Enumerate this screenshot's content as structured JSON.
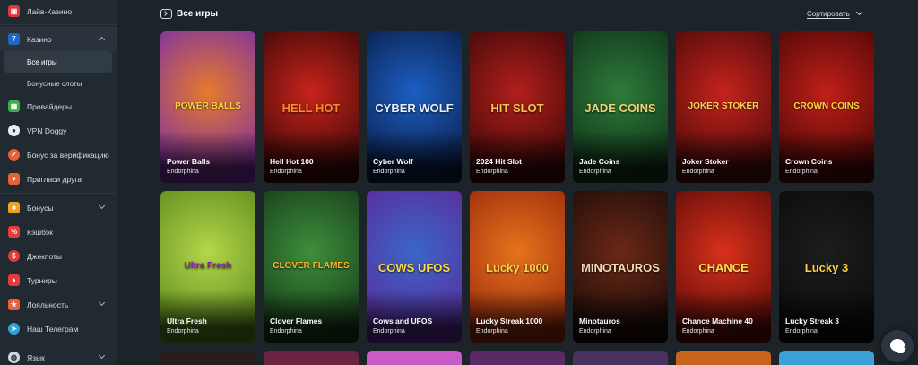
{
  "sidebar": {
    "items": [
      {
        "label": "Лайв-Казино",
        "icon": "live-casino-icon",
        "color": "#e2363b"
      },
      {
        "label": "Казино",
        "icon": "casino-seven-icon",
        "color": "#1f66c6"
      },
      {
        "label": "Все игры"
      },
      {
        "label": "Бонусные слоты"
      },
      {
        "label": "Провайдеры",
        "icon": "providers-icon",
        "color": "#3fae49"
      },
      {
        "label": "VPN Doggy",
        "icon": "vpn-doggy-icon",
        "color": "#e9eef2"
      },
      {
        "label": "Бонус за верификацию",
        "icon": "verification-bonus-icon",
        "color": "#e8603a"
      },
      {
        "label": "Пригласи друга",
        "icon": "invite-friend-icon",
        "color": "#e8603a"
      },
      {
        "label": "Бонусы",
        "icon": "bonuses-icon",
        "color": "#f0a11f"
      },
      {
        "label": "Кэшбэк",
        "icon": "cashback-icon",
        "color": "#e23b3b"
      },
      {
        "label": "Джекпоты",
        "icon": "jackpots-icon",
        "color": "#e23b3b"
      },
      {
        "label": "Турниры",
        "icon": "tournaments-icon",
        "color": "#e23b3b"
      },
      {
        "label": "Лояльность",
        "icon": "loyalty-icon",
        "color": "#e8603a"
      },
      {
        "label": "Наш Телеграм",
        "icon": "telegram-icon",
        "color": "#2aa3dd"
      },
      {
        "label": "Язык",
        "icon": "globe-icon",
        "color": "#cfd6dc"
      }
    ]
  },
  "header": {
    "title": "Все игры",
    "sort_label": "Сортировать"
  },
  "games": [
    {
      "name": "Power Balls",
      "provider": "Endorphina",
      "logo": "POWER BALLS",
      "bg": "#e67a2c",
      "bg2": "#7a2ea6",
      "logo_color": "#ffd23b"
    },
    {
      "name": "Hell Hot 100",
      "provider": "Endorphina",
      "logo": "HELL HOT",
      "bg": "#c8231a",
      "bg2": "#3a0808",
      "logo_color": "#ff8a2a"
    },
    {
      "name": "Cyber Wolf",
      "provider": "Endorphina",
      "logo": "CYBER WOLF",
      "bg": "#1c5fc4",
      "bg2": "#0b1d46",
      "logo_color": "#e6f1ff"
    },
    {
      "name": "2024 Hit Slot",
      "provider": "Endorphina",
      "logo": "HIT SLOT",
      "bg": "#b11f1b",
      "bg2": "#3d0808",
      "logo_color": "#f6c54b"
    },
    {
      "name": "Jade Coins",
      "provider": "Endorphina",
      "logo": "JADE COINS",
      "bg": "#2e7b3a",
      "bg2": "#0e3218",
      "logo_color": "#f2d272"
    },
    {
      "name": "Joker Stoker",
      "provider": "Endorphina",
      "logo": "JOKER STOKER",
      "bg": "#c5231c",
      "bg2": "#4a0a0a",
      "logo_color": "#ffd34f"
    },
    {
      "name": "Crown Coins",
      "provider": "Endorphina",
      "logo": "CROWN COINS",
      "bg": "#c01f17",
      "bg2": "#4c0707",
      "logo_color": "#ffd640"
    },
    {
      "name": "Ultra Fresh",
      "provider": "Endorphina",
      "logo": "Ultra Fresh",
      "bg": "#b6d64a",
      "bg2": "#5b8a1c",
      "logo_color": "#8a1cb3"
    },
    {
      "name": "Clover Flames",
      "provider": "Endorphina",
      "logo": "CLOVER FLAMES",
      "bg": "#3d8f3a",
      "bg2": "#173b1a",
      "logo_color": "#ffb12c"
    },
    {
      "name": "Cows and UFOS",
      "provider": "Endorphina",
      "logo": "COWS UFOS",
      "bg": "#3a66c8",
      "bg2": "#5c2a9a",
      "logo_color": "#ffde3a"
    },
    {
      "name": "Lucky Streak 1000",
      "provider": "Endorphina",
      "logo": "Lucky 1000",
      "bg": "#e6731d",
      "bg2": "#9b2a0c",
      "logo_color": "#ffd24a"
    },
    {
      "name": "Minotauros",
      "provider": "Endorphina",
      "logo": "MINOTAUROS",
      "bg": "#6b2816",
      "bg2": "#1c0c08",
      "logo_color": "#f1dcb8"
    },
    {
      "name": "Chance Machine 40",
      "provider": "Endorphina",
      "logo": "CHANCE",
      "bg": "#d9301b",
      "bg2": "#5e0c08",
      "logo_color": "#ffe14a"
    },
    {
      "name": "Lucky Streak 3",
      "provider": "Endorphina",
      "logo": "Lucky 3",
      "bg": "#1d1d1d",
      "bg2": "#0b0b0b",
      "logo_color": "#ffd23b"
    }
  ]
}
